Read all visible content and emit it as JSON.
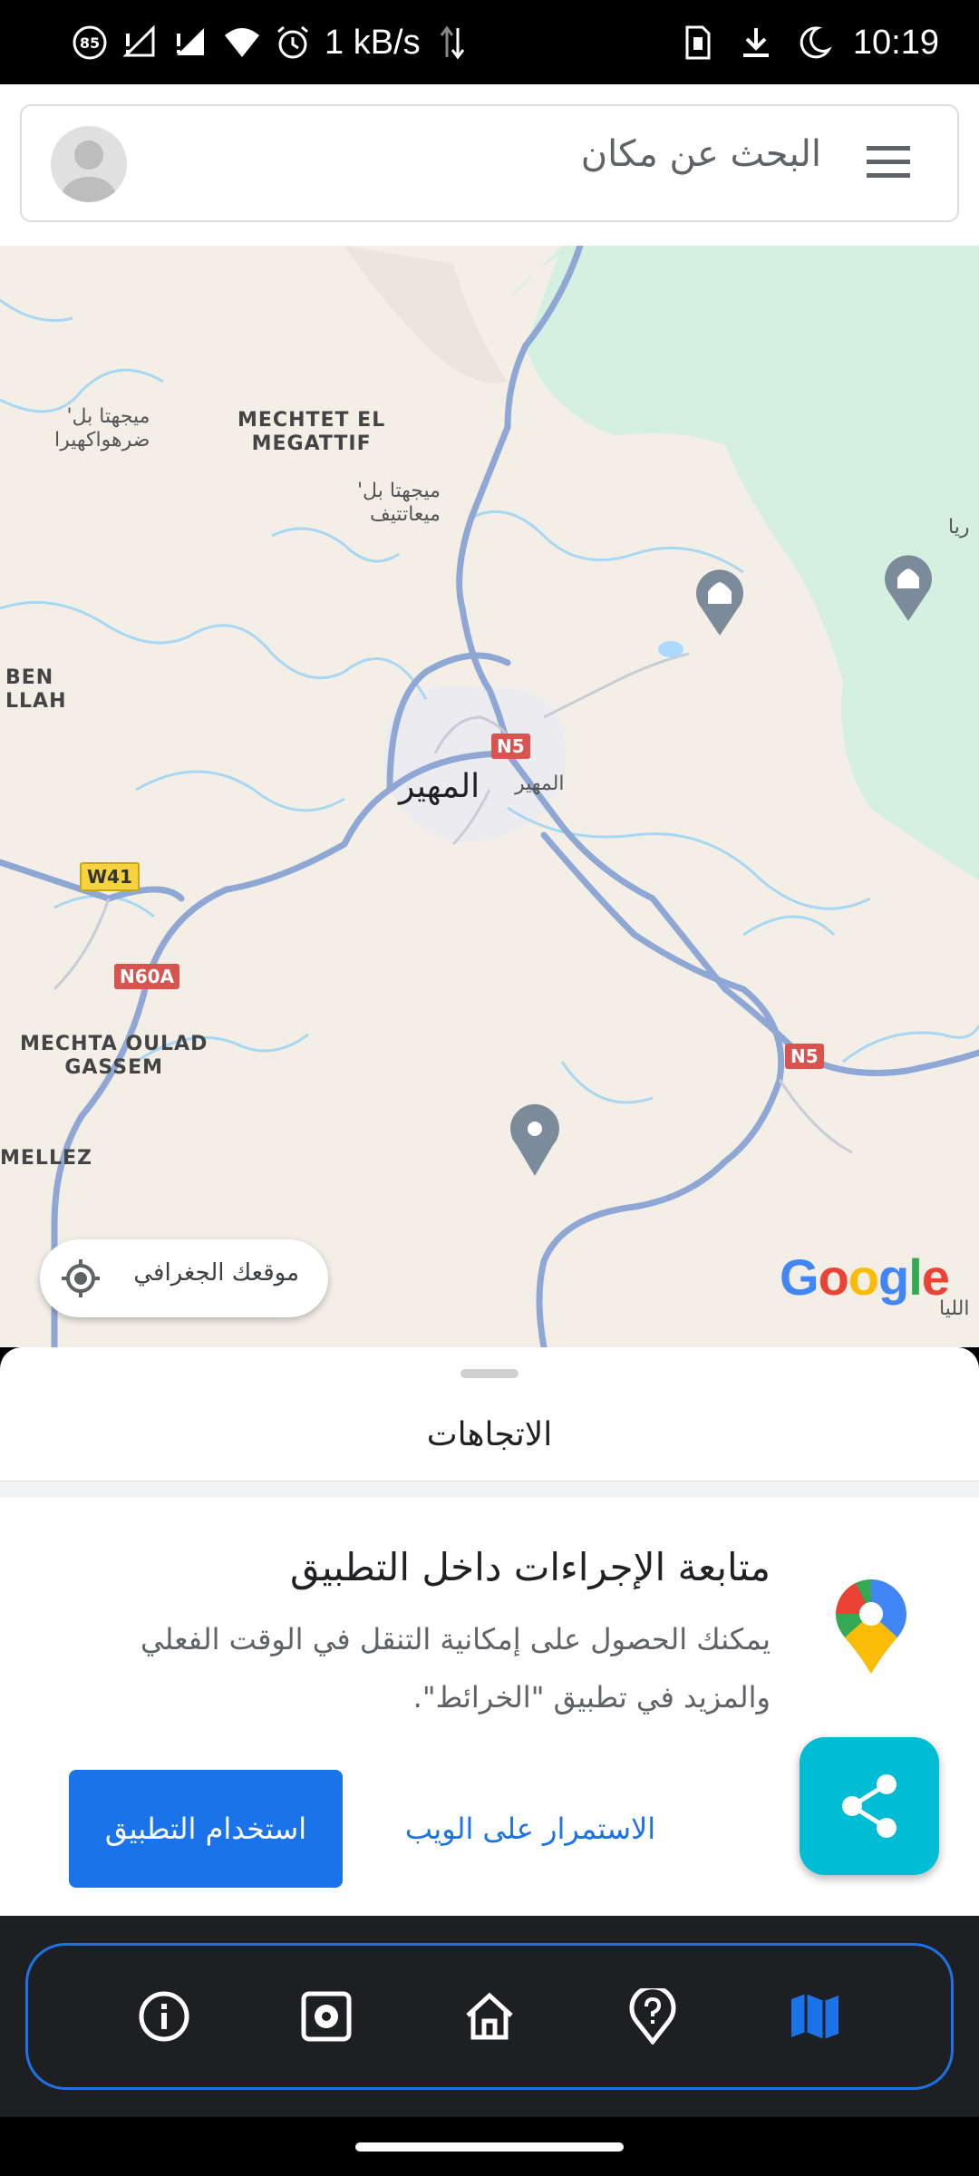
{
  "status_bar": {
    "battery_saver_badge": "85",
    "speed": "1 kB/s",
    "time": "10:19",
    "icons": [
      "battery-saver-icon",
      "signal-no-service-icon",
      "signal-no-service-icon",
      "wifi-icon",
      "alarm-icon",
      "data-activity-icon",
      "sim-icon",
      "download-icon",
      "do-not-disturb-icon"
    ]
  },
  "search": {
    "placeholder": "البحث عن مكان"
  },
  "map": {
    "labels": {
      "mechtet_el_megattif": "MECHTET EL\nMEGATTIF",
      "ar_top_left": "ميجهتا بل'\nضرهواكهيرا",
      "ar_mid": "ميجهتا بل'\nميعاتتيف",
      "ben_allah": "BEN\nLLAH",
      "city": "المهير",
      "city_small": "المهير",
      "mechta_oulad_gassem": "MECHTA OULAD\nGASSEM",
      "mellez": "MELLEZ",
      "right_edge_top": "ريا",
      "right_edge_bottom": "الليا"
    },
    "road_shields": {
      "n5_top": "N5",
      "w41": "W41",
      "n60a": "N60A",
      "n5_right": "N5"
    },
    "geo_button_label": "موقعك الجغرافي",
    "attribution": "Google"
  },
  "sheet": {
    "title": "الاتجاهات",
    "promo_title": "متابعة الإجراءات داخل التطبيق",
    "promo_body": "يمكنك الحصول على إمكانية التنقل في الوقت الفعلي والمزيد في تطبيق \"الخرائط\".",
    "use_app_label": "استخدام التطبيق",
    "continue_web_label": "الاستمرار على الويب"
  },
  "colors": {
    "accent": "#1a73e8",
    "fab": "#00bcd4",
    "nav_bg": "#1e1f23",
    "map_land": "#f3efe7",
    "map_green": "#d5f0e0",
    "map_water": "#aadaff",
    "road": "#8ea7d4"
  },
  "app_nav": {
    "items": [
      "info-icon",
      "settings-icon",
      "home-icon",
      "help-location-icon",
      "map-icon"
    ],
    "active": "map-icon"
  }
}
